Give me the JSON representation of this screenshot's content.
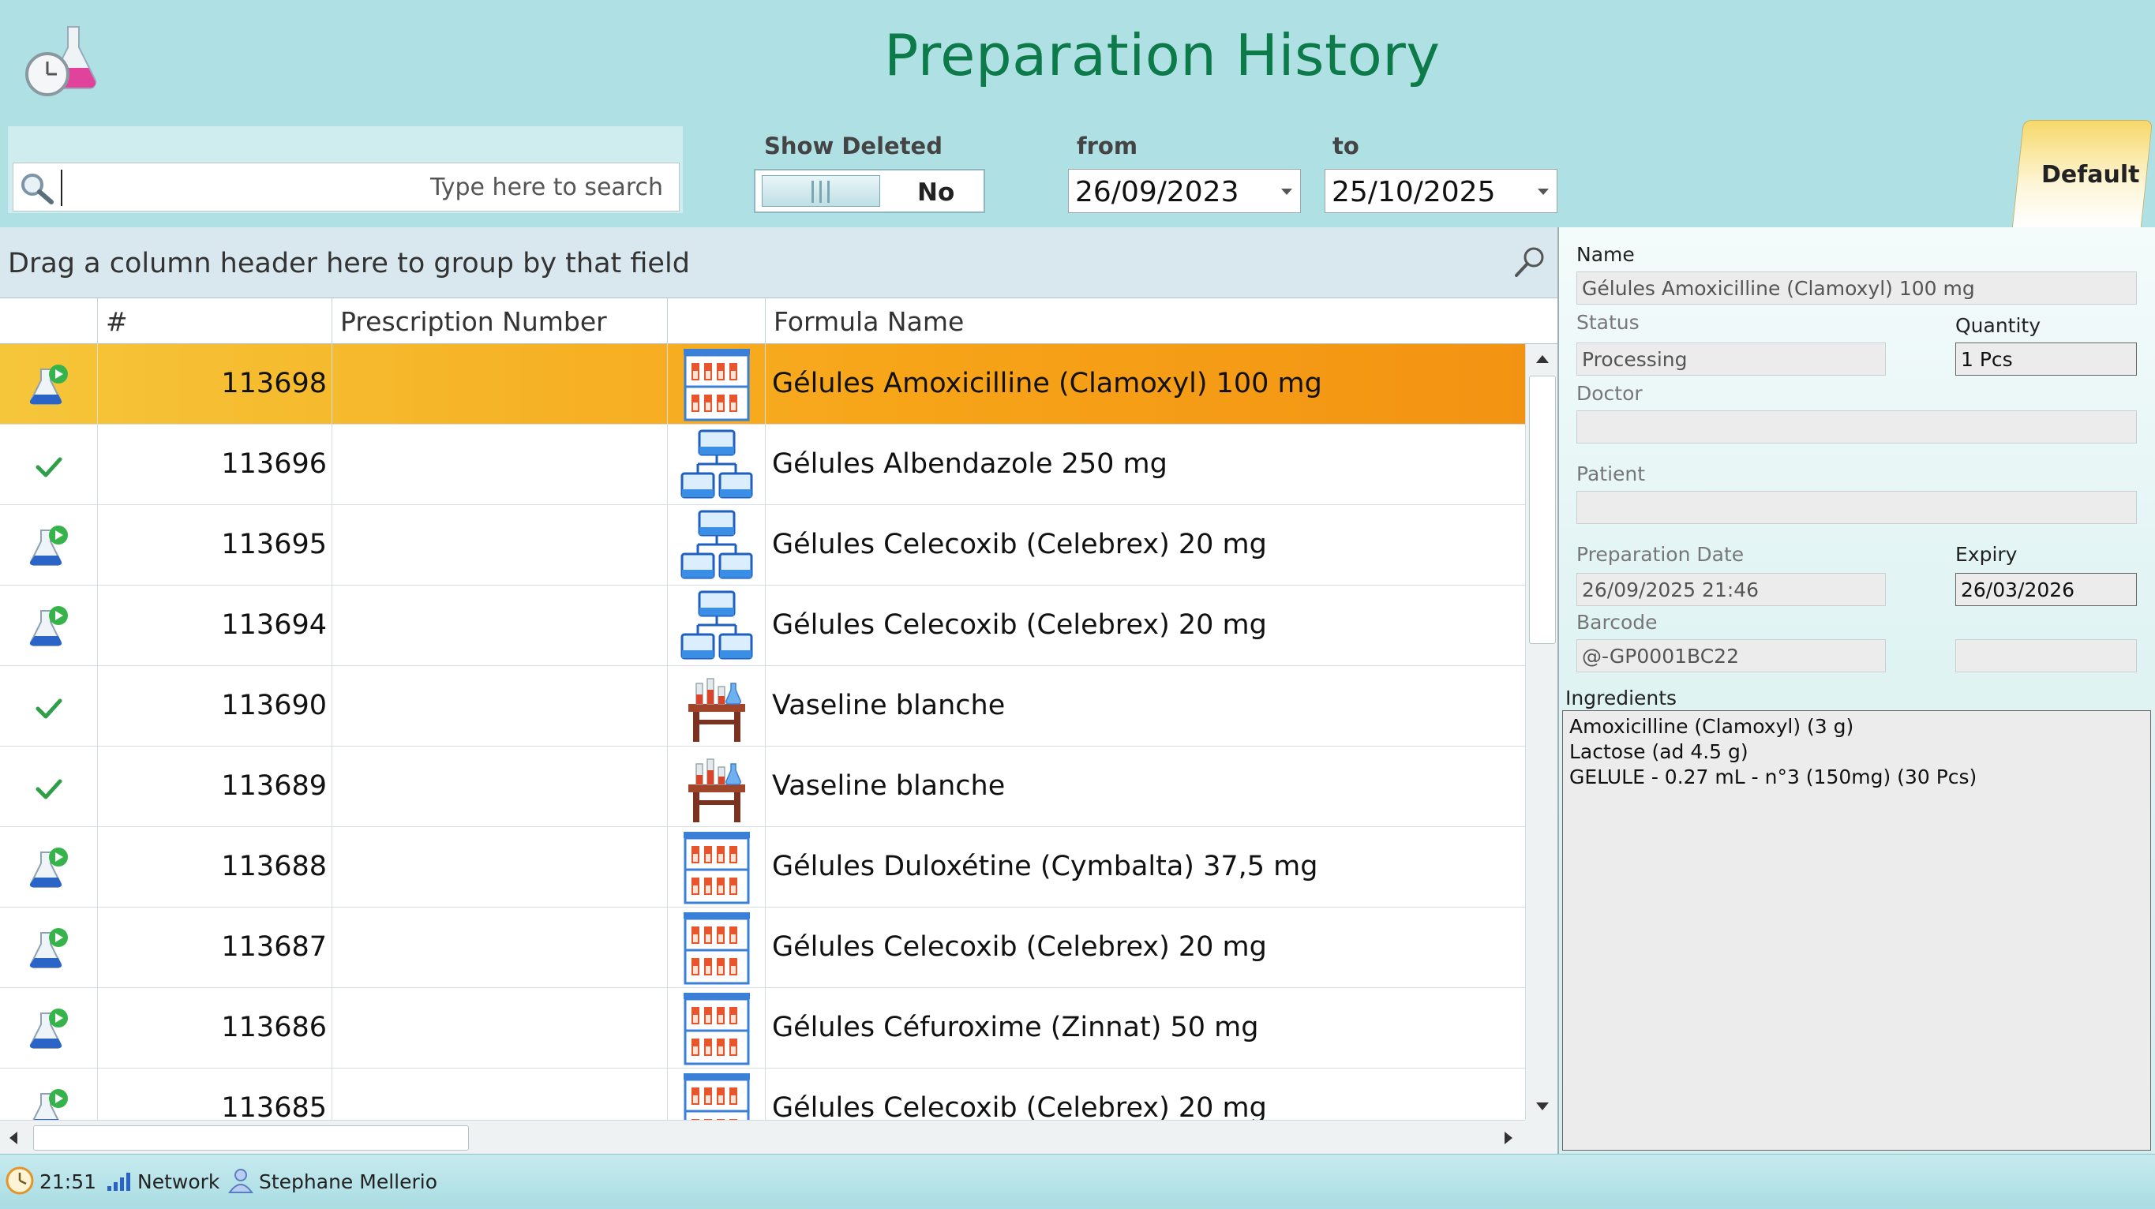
{
  "window": {
    "title": "Preparation History"
  },
  "search": {
    "placeholder": "Type here to search",
    "value": ""
  },
  "filters": {
    "show_deleted_label": "Show Deleted",
    "show_deleted_value": "No",
    "from_label": "from",
    "from_value": "26/09/2023",
    "to_label": "to",
    "to_value": "25/10/2025"
  },
  "tab": {
    "label": "Default"
  },
  "grid": {
    "group_hint": "Drag a column header here to group by that field",
    "columns": [
      "",
      "#",
      "Prescription Number",
      "",
      "Formula Name"
    ],
    "rows": [
      {
        "status": "in-progress",
        "number": "113698",
        "prescription": "",
        "form": "capsules-shelf",
        "formula": "Gélules Amoxicilline (Clamoxyl) 100 mg",
        "selected": true
      },
      {
        "status": "done",
        "number": "113696",
        "prescription": "",
        "form": "network-boxes",
        "formula": "Gélules Albendazole 250 mg",
        "selected": false
      },
      {
        "status": "in-progress",
        "number": "113695",
        "prescription": "",
        "form": "network-boxes",
        "formula": "Gélules Celecoxib (Celebrex) 20 mg",
        "selected": false
      },
      {
        "status": "in-progress",
        "number": "113694",
        "prescription": "",
        "form": "network-boxes",
        "formula": "Gélules Celecoxib (Celebrex) 20 mg",
        "selected": false
      },
      {
        "status": "done",
        "number": "113690",
        "prescription": "",
        "form": "lab-table",
        "formula": "Vaseline blanche",
        "selected": false
      },
      {
        "status": "done",
        "number": "113689",
        "prescription": "",
        "form": "lab-table",
        "formula": "Vaseline blanche",
        "selected": false
      },
      {
        "status": "in-progress",
        "number": "113688",
        "prescription": "",
        "form": "capsules-shelf",
        "formula": "Gélules Duloxétine (Cymbalta) 37,5 mg",
        "selected": false
      },
      {
        "status": "in-progress",
        "number": "113687",
        "prescription": "",
        "form": "capsules-shelf",
        "formula": "Gélules Celecoxib (Celebrex) 20 mg",
        "selected": false
      },
      {
        "status": "in-progress",
        "number": "113686",
        "prescription": "",
        "form": "capsules-shelf",
        "formula": "Gélules Céfuroxime (Zinnat) 50 mg",
        "selected": false
      },
      {
        "status": "in-progress",
        "number": "113685",
        "prescription": "",
        "form": "capsules-shelf",
        "formula": "Gélules Celecoxib (Celebrex) 20 mg",
        "selected": false
      }
    ]
  },
  "details": {
    "name_label": "Name",
    "name_value": "Gélules Amoxicilline (Clamoxyl) 100 mg",
    "status_label": "Status",
    "status_value": "Processing",
    "quantity_label": "Quantity",
    "quantity_value": "1 Pcs",
    "doctor_label": "Doctor",
    "doctor_value": "",
    "patient_label": "Patient",
    "patient_value": "",
    "prep_date_label": "Preparation Date",
    "prep_date_value": "26/09/2025 21:46",
    "expiry_label": "Expiry",
    "expiry_value": "26/03/2026",
    "barcode_label": "Barcode",
    "barcode_value": "@-GP0001BC22",
    "barcode_extra_value": "",
    "ingredients_label": "Ingredients",
    "ingredients": [
      "Amoxicilline (Clamoxyl) (3 g)",
      "Lactose (ad 4.5 g)",
      "GELULE - 0.27 mL - n°3 (150mg) (30 Pcs)"
    ]
  },
  "statusbar": {
    "time": "21:51",
    "network": "Network",
    "user": "Stephane Mellerio"
  },
  "colors": {
    "accent": "#0d7a4a",
    "background": "#afe0e4",
    "selected_row": "#f7a418"
  }
}
